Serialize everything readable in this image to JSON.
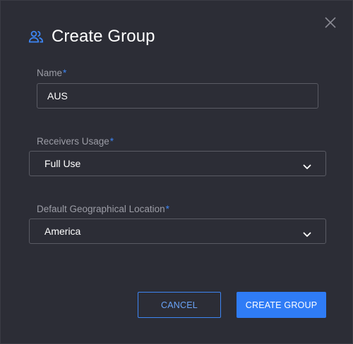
{
  "dialog": {
    "title": "Create Group",
    "title_icon": "users-icon",
    "close_icon": "close-icon"
  },
  "fields": {
    "name": {
      "label": "Name",
      "required_mark": "*",
      "value": "AUS"
    },
    "receivers_usage": {
      "label": "Receivers Usage",
      "required_mark": "*",
      "selected": "Full Use",
      "icon": "chevron-down-icon"
    },
    "location": {
      "label": "Default Geographical Location",
      "required_mark": "*",
      "selected": "America",
      "icon": "chevron-down-icon"
    }
  },
  "actions": {
    "cancel_label": "CANCEL",
    "create_label": "CREATE GROUP"
  },
  "colors": {
    "accent": "#2f7cf6",
    "background": "#2c2d36",
    "label": "#9c9da6"
  }
}
